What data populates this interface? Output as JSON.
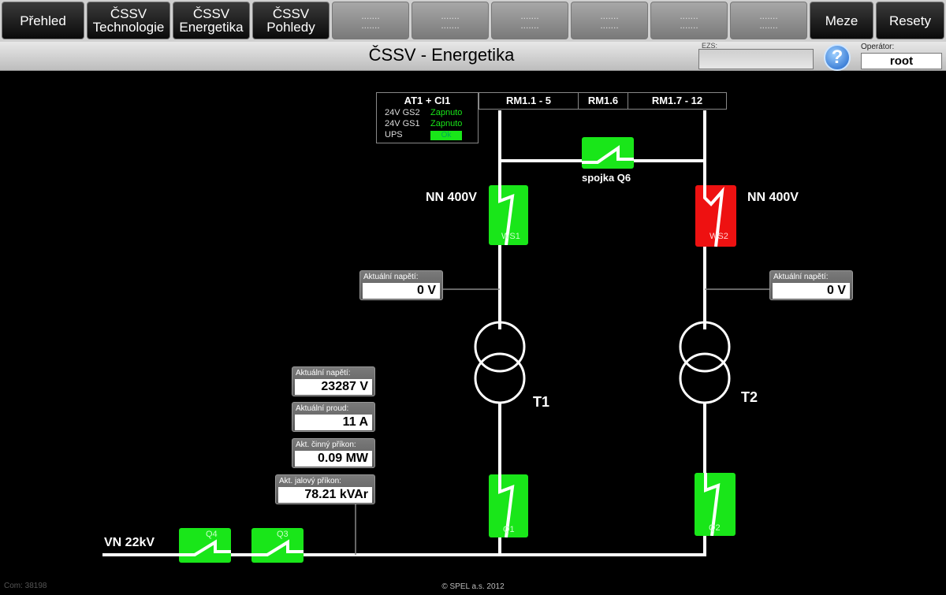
{
  "nav": {
    "prehled": "Přehled",
    "cssv_tech_1": "ČSSV",
    "cssv_tech_2": "Technologie",
    "cssv_energ_1": "ČSSV",
    "cssv_energ_2": "Energetika",
    "cssv_pohl_1": "ČSSV",
    "cssv_pohl_2": "Pohledy",
    "placeholder": ".......",
    "meze": "Meze",
    "resety": "Resety"
  },
  "titlebar": {
    "title": "ČSSV - Energetika",
    "ezs_label": "EZS:",
    "help": "?",
    "operator_label": "Operátor:",
    "operator_value": "root"
  },
  "status": {
    "title": "AT1 + CI1",
    "row1_label": "24V GS2",
    "row1_value": "Zapnuto",
    "row2_label": "24V GS1",
    "row2_value": "Zapnuto",
    "row3_label": "UPS",
    "row3_value": "Ok"
  },
  "rm": {
    "a": "RM1.1 - 5",
    "b": "RM1.6",
    "c": "RM1.7 - 12"
  },
  "labels": {
    "spojka": "spojka Q6",
    "nn_left": "NN 400V",
    "nn_right": "NN 400V",
    "t1": "T1",
    "t2": "T2",
    "vn": "VN 22kV"
  },
  "switches": {
    "ws1": "WS1",
    "ws2": "WS2",
    "q1": "Q1",
    "q2": "Q2",
    "q3": "Q3",
    "q4": "Q4"
  },
  "values": {
    "left_voltage": {
      "caption": "Aktuální napětí:",
      "value": "0 V"
    },
    "right_voltage": {
      "caption": "Aktuální napětí:",
      "value": "0 V"
    },
    "vn_voltage": {
      "caption": "Aktuální napětí:",
      "value": "23287 V"
    },
    "vn_current": {
      "caption": "Aktuální proud:",
      "value": "11 A"
    },
    "active_power": {
      "caption": "Akt. činný příkon:",
      "value": "0.09 MW"
    },
    "reactive_power": {
      "caption": "Akt. jalový příkon:",
      "value": "78.21 kVAr"
    }
  },
  "footer": {
    "left": "Com:  38198",
    "center": "© SPEL a.s. 2012"
  },
  "colors": {
    "on": "#19e619",
    "off": "#ee1111"
  }
}
